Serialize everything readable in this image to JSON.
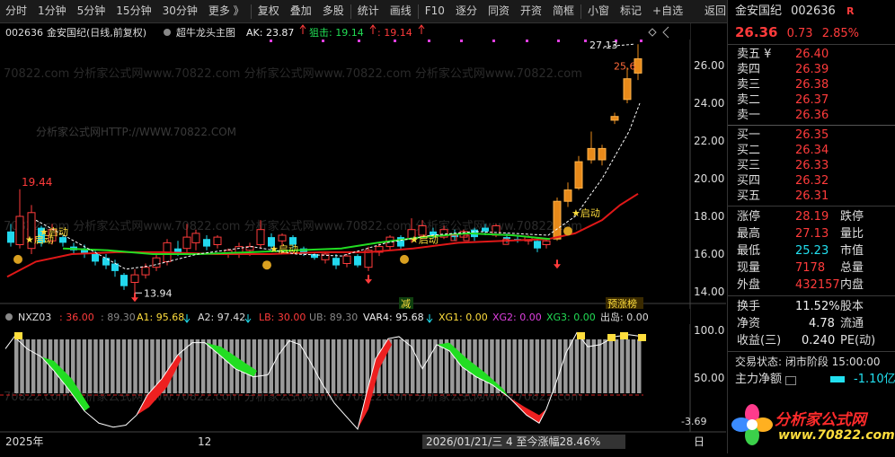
{
  "toolbar": {
    "items": [
      "分时",
      "1分钟",
      "5分钟",
      "15分钟",
      "30分钟",
      "更多 》",
      "复权",
      "叠加",
      "多股",
      "统计",
      "画线",
      "F10",
      "逐分",
      "同资",
      "开资",
      "简框",
      "小窗",
      "标记",
      "+自选"
    ],
    "back": "返回"
  },
  "main_chart": {
    "header": {
      "code": "002636",
      "name": "金安国纪(日线,前复权)",
      "indicator": "超牛龙头主图",
      "ak_label": "AK: 23.87",
      "zj_label": "狙击: 19.14",
      "zj2_label": ": 19.14"
    },
    "watermark_url": "分析家公式网HTTP://WWW.70822.COM",
    "watermark_repeat": "70822.com 分析家公式网www.70822.com 分析家公式网www.70822.com 分析家公式网www.70822.com",
    "price_axis": [
      "26.00",
      "24.00",
      "22.00",
      "20.00",
      "18.00",
      "16.00",
      "14.00"
    ],
    "annotations": {
      "high_top": "27.13",
      "high_left": "19.44",
      "low": "13.94",
      "last_price_tag": "25.6",
      "start": "★启动",
      "reduce": "减",
      "pre_limit": "预涨榜"
    }
  },
  "sub_chart": {
    "header": {
      "name": "NXZ03",
      "v1": ": 36.00",
      "v2": ": 89.30",
      "a1": "A1: 95.68",
      "a2": "A2: 97.42",
      "lb": "LB: 30.00",
      "ub": "UB: 89.30",
      "var4": "VAR4: 95.68",
      "xg1": "XG1: 0.00",
      "xg2": "XG2: 0.00",
      "xg3": "XG3: 0.00",
      "out": "出岛: 0.00"
    },
    "axis": [
      "100.0",
      "50.00"
    ],
    "bottom_value": "-3.69"
  },
  "bottom_bar": {
    "year": "2025年",
    "month": "12",
    "status": "2026/01/21/三 4 至今涨幅28.46%",
    "right": "日"
  },
  "side": {
    "name": "金安国纪",
    "code": "002636",
    "badge": "R",
    "price": "26.36",
    "change": "0.73",
    "change_pct": "2.85%",
    "sell": [
      {
        "label": "卖五 ¥",
        "value": "26.40"
      },
      {
        "label": "卖四",
        "value": "26.39"
      },
      {
        "label": "卖三",
        "value": "26.38"
      },
      {
        "label": "卖二",
        "value": "26.37"
      },
      {
        "label": "卖一",
        "value": "26.36"
      }
    ],
    "buy": [
      {
        "label": "买一",
        "value": "26.35"
      },
      {
        "label": "买二",
        "value": "26.34"
      },
      {
        "label": "买三",
        "value": "26.33"
      },
      {
        "label": "买四",
        "value": "26.32"
      },
      {
        "label": "买五",
        "value": "26.31"
      }
    ],
    "stats": {
      "limit_up_label": "涨停",
      "limit_up": "28.19",
      "limit_down_label": "跌停",
      "high_label": "最高",
      "high": "27.13",
      "vol_ratio_label": "量比",
      "low_label": "最低",
      "low": "25.23",
      "mcap_label": "市值",
      "now_label": "现量",
      "now": "7178",
      "total_label": "总量",
      "outer_label": "外盘",
      "outer": "432157",
      "inner_label": "内盘",
      "turnover_label": "换手",
      "turnover": "11.52%",
      "equity_label": "股本",
      "nav_label": "净资",
      "nav": "4.78",
      "float_label": "流通",
      "eps_label": "收益(三)",
      "eps": "0.240",
      "pe_label": "PE(动)"
    },
    "trade_status": "交易状态: 闭市阶段 15:00:00",
    "main_flow_label": "主力净额",
    "main_flow_value": "-1.10亿",
    "logo_text": "分析家公式网",
    "logo_url": "www.70822.com"
  }
}
